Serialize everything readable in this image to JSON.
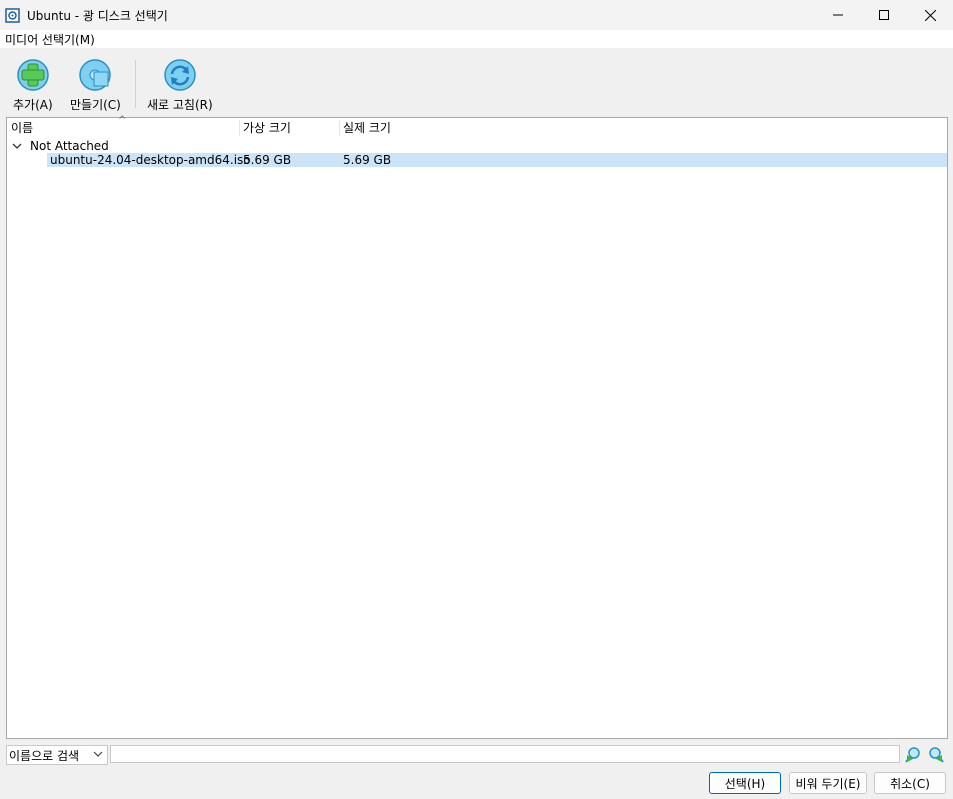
{
  "window": {
    "title": "Ubuntu - 광 디스크 선택기"
  },
  "menubar": {
    "items": [
      "미디어 선택기(M)"
    ]
  },
  "toolbar": {
    "add_label": "추가(A)",
    "create_label": "만들기(C)",
    "refresh_label": "새로 고침(R)"
  },
  "table": {
    "headers": [
      "이름",
      "가상 크기",
      "실제 크기"
    ],
    "group_label": "Not Attached",
    "rows": [
      {
        "name": "ubuntu-24.04-desktop-amd64.iso",
        "virtual_size": "5.69 GB",
        "actual_size": "5.69 GB"
      }
    ]
  },
  "search": {
    "mode_selected": "이름으로 검색",
    "value": ""
  },
  "buttons": {
    "choose": "선택(H)",
    "leave_empty": "비워 두기(E)",
    "cancel": "취소(C)"
  },
  "colors": {
    "selection": "#cce4f7",
    "icon_green": "#5cc85c",
    "icon_blue": "#3aa8e8",
    "primary_border": "#0067c0"
  }
}
